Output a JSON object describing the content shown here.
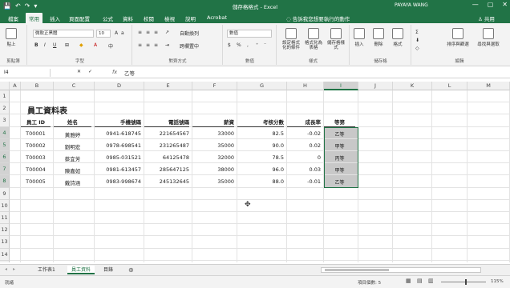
{
  "window": {
    "title": "儲存格格式 - Excel",
    "user": "PAYAYA WANG",
    "qat": [
      "💾",
      "↶",
      "↷",
      "▾"
    ],
    "controls": [
      "—",
      "▢",
      "✕"
    ]
  },
  "ribbon": {
    "tabs": [
      "檔案",
      "常用",
      "插入",
      "頁面配置",
      "公式",
      "資料",
      "校閱",
      "檢視",
      "說明",
      "Acrobat"
    ],
    "active_tab": "常用",
    "search_placeholder": "告訴我您想要執行的動作",
    "share": "共用",
    "clipboard": {
      "paste": "貼上",
      "label": "剪貼簿"
    },
    "font": {
      "name": "微軟正黑體",
      "size": "10",
      "label": "字型"
    },
    "alignment": {
      "wrap": "自動換列",
      "merge": "跨欄置中",
      "label": "對齊方式"
    },
    "number": {
      "format": "數值",
      "label": "數值"
    },
    "styles": {
      "conditional": "設定格式化的條件",
      "as_table": "格式化為表格",
      "cell_styles": "儲存格樣式",
      "label": "樣式"
    },
    "cells": {
      "insert": "插入",
      "delete": "刪除",
      "format": "格式",
      "label": "儲存格"
    },
    "editing": {
      "sort": "排序與篩選",
      "find": "尋找與選取",
      "label": "編輯"
    }
  },
  "formula_bar": {
    "name_box": "I4",
    "fx": "fx",
    "content": "乙等"
  },
  "sheet": {
    "columns": [
      "A",
      "B",
      "C",
      "D",
      "E",
      "F",
      "G",
      "H",
      "I",
      "J",
      "K",
      "L",
      "M"
    ],
    "rows": [
      "1",
      "2",
      "3",
      "4",
      "5",
      "6",
      "7",
      "8",
      "9",
      "10",
      "11",
      "12",
      "13",
      "14",
      "15",
      "16"
    ],
    "selected_column": "I",
    "selected_rows": [
      "4",
      "5",
      "6",
      "7",
      "8"
    ],
    "table_title": "員工資料表",
    "headers": [
      "員工 ID",
      "姓名",
      "手機號碼",
      "電話號碼",
      "薪資",
      "考核分數",
      "成長率",
      "等第"
    ],
    "records": [
      {
        "id": "T00001",
        "name": "黃雅婷",
        "mobile": "0941-618745",
        "phone": "221654567",
        "salary": "33000",
        "score": "82.5",
        "growth": "-0.02",
        "grade": "乙等"
      },
      {
        "id": "T00002",
        "name": "劉明宏",
        "mobile": "0978-698541",
        "phone": "231265487",
        "salary": "35000",
        "score": "90.0",
        "growth": "0.02",
        "grade": "甲等"
      },
      {
        "id": "T00003",
        "name": "蔡宜芳",
        "mobile": "0985-031521",
        "phone": "64125478",
        "salary": "32000",
        "score": "78.5",
        "growth": "0",
        "grade": "丙等"
      },
      {
        "id": "T00004",
        "name": "陳嘉如",
        "mobile": "0981-613457",
        "phone": "285647125",
        "salary": "38000",
        "score": "96.0",
        "growth": "0.03",
        "grade": "甲等"
      },
      {
        "id": "T00005",
        "name": "戴詩涵",
        "mobile": "0983-998674",
        "phone": "245132645",
        "salary": "35000",
        "score": "88.0",
        "growth": "-0.01",
        "grade": "乙等"
      }
    ]
  },
  "sheet_tabs": {
    "tabs": [
      "工作表1",
      "員工資料",
      "目錄"
    ],
    "active": "員工資料",
    "add": "⊕"
  },
  "status_bar": {
    "ready": "就緒",
    "count_label": "項目個數: 5",
    "zoom": "115%"
  }
}
